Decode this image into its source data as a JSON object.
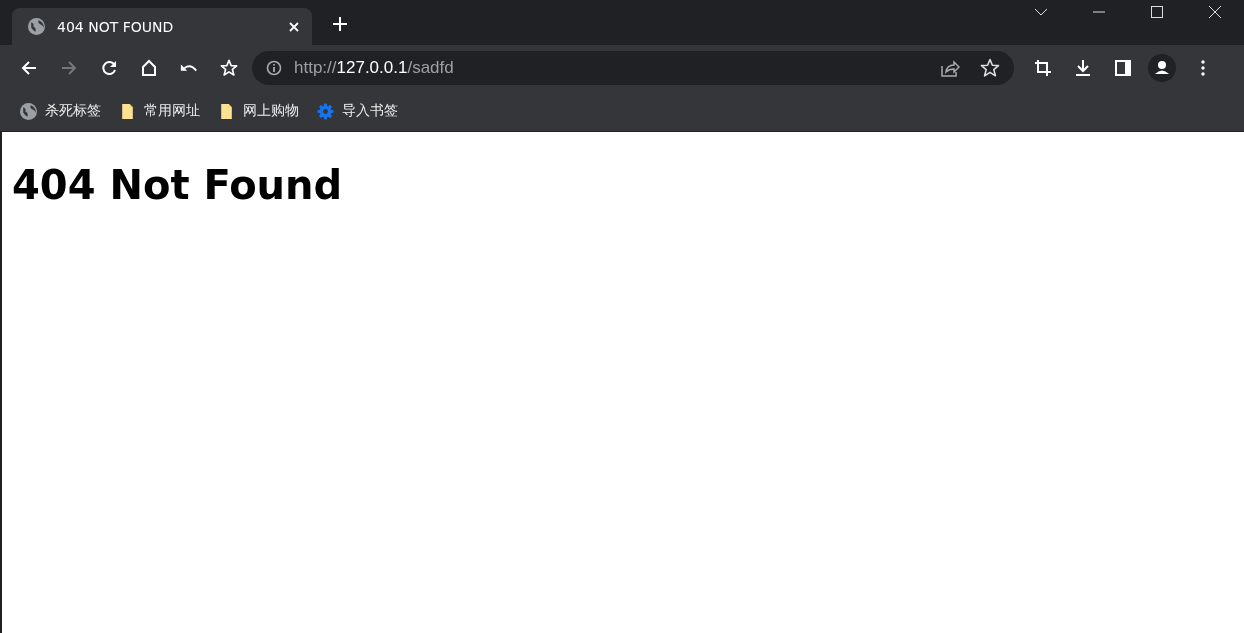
{
  "tabs": [
    {
      "title": "404 NOT FOUND",
      "selected": true
    }
  ],
  "address": {
    "scheme": "http://",
    "host": "127.0.0.1",
    "path": "/sadfd"
  },
  "bookmarks": [
    {
      "kind": "site",
      "label": "杀死标签"
    },
    {
      "kind": "folder",
      "label": "常用网址"
    },
    {
      "kind": "folder",
      "label": "网上购物"
    },
    {
      "kind": "settings",
      "label": "导入书签"
    }
  ],
  "page": {
    "heading": "404 Not Found"
  }
}
